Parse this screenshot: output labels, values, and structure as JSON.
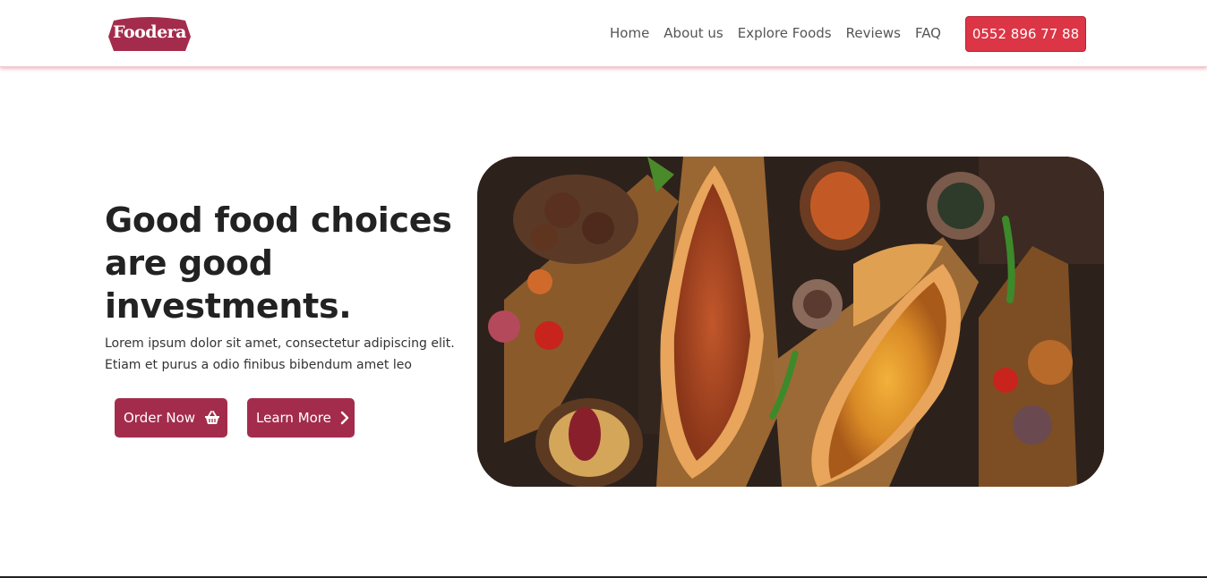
{
  "brand": {
    "name": "Foodera",
    "color": "#a32c4c"
  },
  "nav": {
    "links": [
      "Home",
      "About us",
      "Explore Foods",
      "Reviews",
      "FAQ"
    ],
    "phone": "0552 896 77 88",
    "phone_color": "#dc3545"
  },
  "hero": {
    "heading": "Good food choices are good investments.",
    "text": "Lorem ipsum dolor sit amet, consectetur adipiscing elit. Etiam et purus a odio finibus bibendum amet leo",
    "order_button": {
      "label": "Order Now",
      "icon": "basket-icon"
    },
    "learn_button": {
      "label": "Learn More",
      "icon": "chevron-right-icon"
    },
    "image": {
      "subject": "turkish-pide-food-spread"
    }
  }
}
